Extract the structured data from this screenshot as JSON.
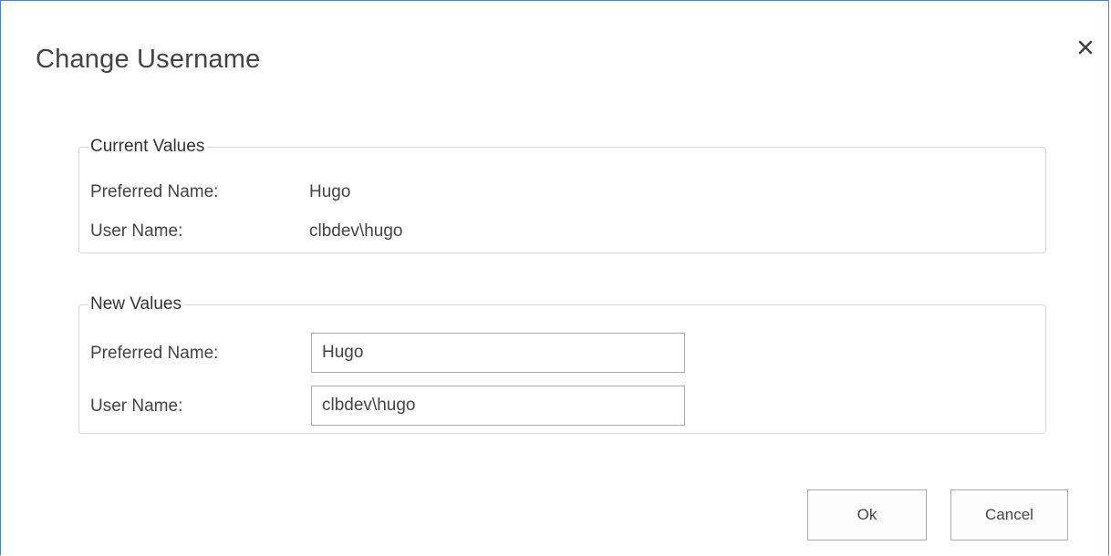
{
  "dialog": {
    "title": "Change Username",
    "close_icon": "close-icon"
  },
  "current_values": {
    "legend": "Current Values",
    "preferred_name_label": "Preferred Name:",
    "preferred_name_value": "Hugo",
    "user_name_label": "User Name:",
    "user_name_value": "clbdev\\hugo"
  },
  "new_values": {
    "legend": "New Values",
    "preferred_name_label": "Preferred Name:",
    "preferred_name_value": "Hugo",
    "user_name_label": "User Name:",
    "user_name_value": "clbdev\\hugo"
  },
  "buttons": {
    "ok_label": "Ok",
    "cancel_label": "Cancel"
  },
  "colors": {
    "dialog_border": "#5a7fb3",
    "text": "#444444",
    "group_border": "#d6d6d6",
    "input_border": "#ababab"
  }
}
